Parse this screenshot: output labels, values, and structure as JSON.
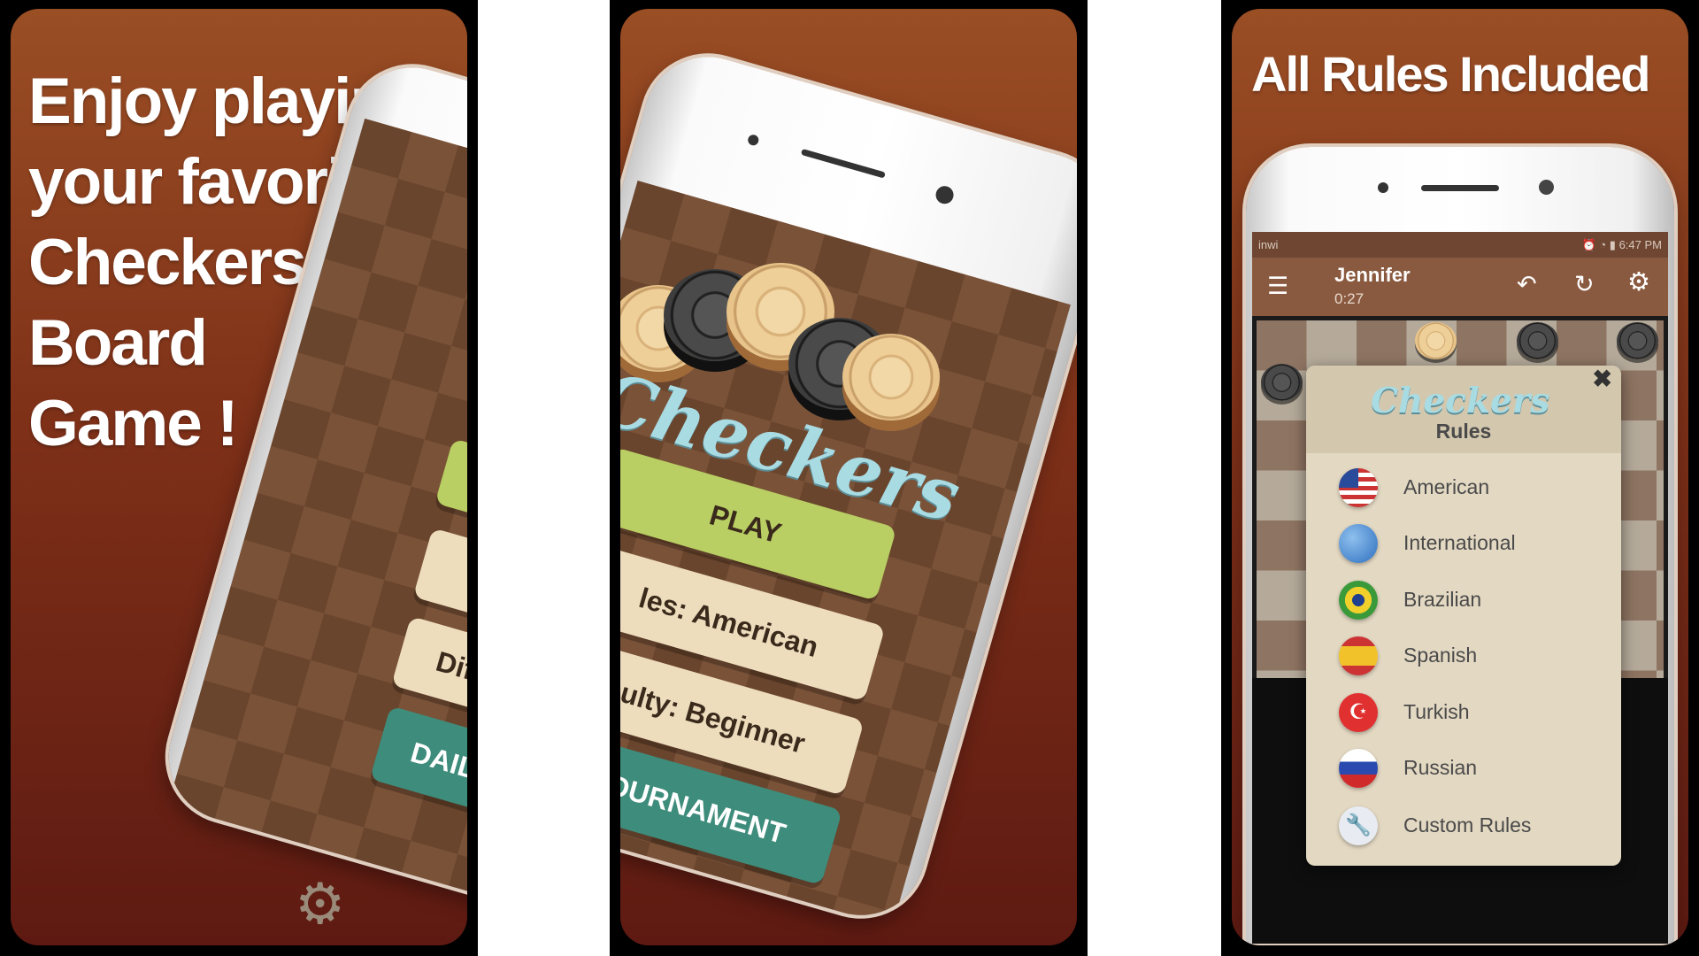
{
  "colors": {
    "brand_brown": "#8a3a1c",
    "play_green": "#b9cf63",
    "tournament_teal": "#3e8c7b",
    "logo_blue": "#a9dbe3"
  },
  "panel1": {
    "headline_lines": [
      "Enjoy playing",
      "your favorite",
      "Checkers",
      "Board",
      "Game !"
    ],
    "buttons": {
      "difficulty_partial": "Dif",
      "daily_partial": "DAIL"
    },
    "icons": [
      "gear-icon"
    ]
  },
  "panel2": {
    "logo": "Checkers",
    "buttons": {
      "play": "PLAY",
      "rules_partial": "les: American",
      "difficulty_partial": "ulty: Beginner",
      "tournament_partial": "OURNAMENT"
    }
  },
  "panel3": {
    "headline": "All Rules Included",
    "status_bar": {
      "carrier": "inwi",
      "time": "6:47 PM"
    },
    "app_bar": {
      "player": "Jennifer",
      "timer": "0:27",
      "icons": [
        "menu-icon",
        "undo-icon",
        "restart-icon",
        "settings-icon"
      ]
    },
    "dialog": {
      "logo": "Checkers",
      "title": "Rules",
      "close_icon": "close-icon",
      "items": [
        {
          "label": "American",
          "icon": "us-flag-icon"
        },
        {
          "label": "International",
          "icon": "globe-icon"
        },
        {
          "label": "Brazilian",
          "icon": "brazil-flag-icon"
        },
        {
          "label": "Spanish",
          "icon": "spain-flag-icon"
        },
        {
          "label": "Turkish",
          "icon": "turkey-flag-icon"
        },
        {
          "label": "Russian",
          "icon": "russia-flag-icon"
        },
        {
          "label": "Custom Rules",
          "icon": "wrench-icon"
        }
      ]
    }
  }
}
